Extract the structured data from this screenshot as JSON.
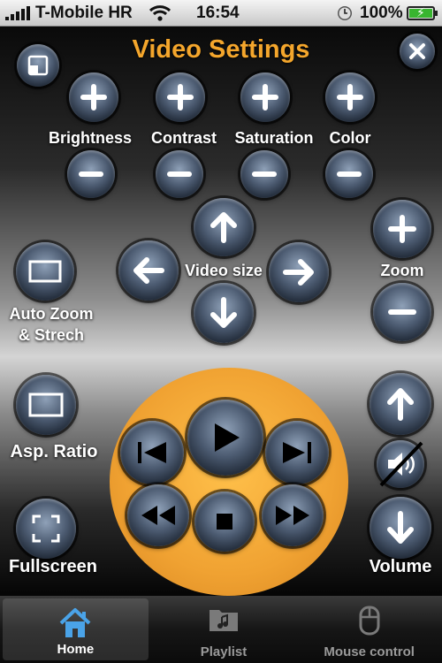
{
  "status_bar": {
    "carrier": "T-Mobile HR",
    "time": "16:54",
    "battery": "100%"
  },
  "title": "Video Settings",
  "adjust": {
    "brightness": "Brightness",
    "contrast": "Contrast",
    "saturation": "Saturation",
    "color": "Color"
  },
  "video_size_label": "Video size",
  "zoom_label": "Zoom",
  "auto_zoom_label_line1": "Auto Zoom",
  "auto_zoom_label_line2": "& Strech",
  "aspect_ratio_label": "Asp. Ratio",
  "fullscreen_label": "Fullscreen",
  "volume_label": "Volume",
  "tabs": [
    {
      "label": "Home",
      "icon": "home-icon"
    },
    {
      "label": "Playlist",
      "icon": "playlist-folder-icon"
    },
    {
      "label": "Mouse control",
      "icon": "mouse-icon"
    }
  ],
  "colors": {
    "title": "#f4a62c",
    "playback_disc": "#f0a232",
    "tab_active_icon": "#4aa3e8"
  }
}
